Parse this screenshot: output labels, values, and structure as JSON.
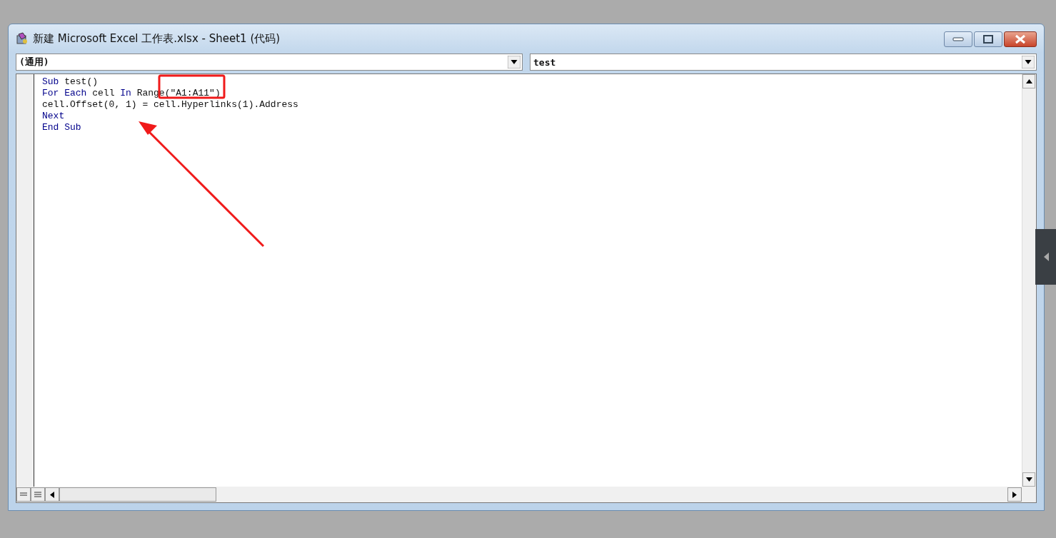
{
  "window": {
    "title": "新建 Microsoft Excel 工作表.xlsx - Sheet1 (代码)"
  },
  "object_dropdown": {
    "value": "(通用)"
  },
  "procedure_dropdown": {
    "value": "test"
  },
  "code_lines": [
    [
      {
        "text": "Sub",
        "kind": "keyword"
      },
      {
        "text": " test()",
        "kind": "plain"
      }
    ],
    [
      {
        "text": "For ",
        "kind": "keyword"
      },
      {
        "text": "Each",
        "kind": "keyword"
      },
      {
        "text": " cell ",
        "kind": "plain"
      },
      {
        "text": "In",
        "kind": "keyword"
      },
      {
        "text": " Range(\"A1:A11\")",
        "kind": "plain"
      }
    ],
    [
      {
        "text": "cell.Offset(0, 1) = cell.Hyperlinks(1).Address",
        "kind": "plain"
      }
    ],
    [
      {
        "text": "Next",
        "kind": "keyword"
      }
    ],
    [
      {
        "text": "End Sub",
        "kind": "keyword"
      }
    ]
  ]
}
